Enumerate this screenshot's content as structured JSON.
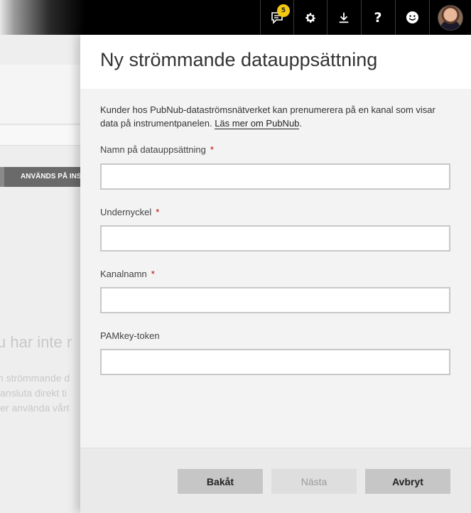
{
  "topbar": {
    "notification_count": "5",
    "icons": [
      "notifications-icon",
      "gear-icon",
      "download-icon",
      "help-icon",
      "smiley-icon",
      "avatar"
    ]
  },
  "background": {
    "tab_label": "ANVÄNDS PÅ INST",
    "heading_fragment": "u har inte r",
    "line1": "n strömmande d",
    "line2": "ansluta direkt ti",
    "line3": "ler använda vårt"
  },
  "panel": {
    "title": "Ny strömmande datauppsättning",
    "description": "Kunder hos PubNub-dataströmsnätverket kan prenumerera på en kanal som visar data på instrumentpanelen.",
    "learn_more_link": "Läs mer om PubNub",
    "fields": [
      {
        "label": "Namn på datauppsättning",
        "required": "*",
        "value": ""
      },
      {
        "label": "Undernyckel",
        "required": "*",
        "value": ""
      },
      {
        "label": "Kanalnamn",
        "required": "*",
        "value": ""
      },
      {
        "label": "PAMkey-token",
        "required": "",
        "value": ""
      }
    ]
  },
  "footer": {
    "back_label": "Bakåt",
    "next_label": "Nästa",
    "cancel_label": "Avbryt"
  },
  "colors": {
    "badge": "#f2c811",
    "required": "#c00000",
    "topbar": "#000000"
  }
}
